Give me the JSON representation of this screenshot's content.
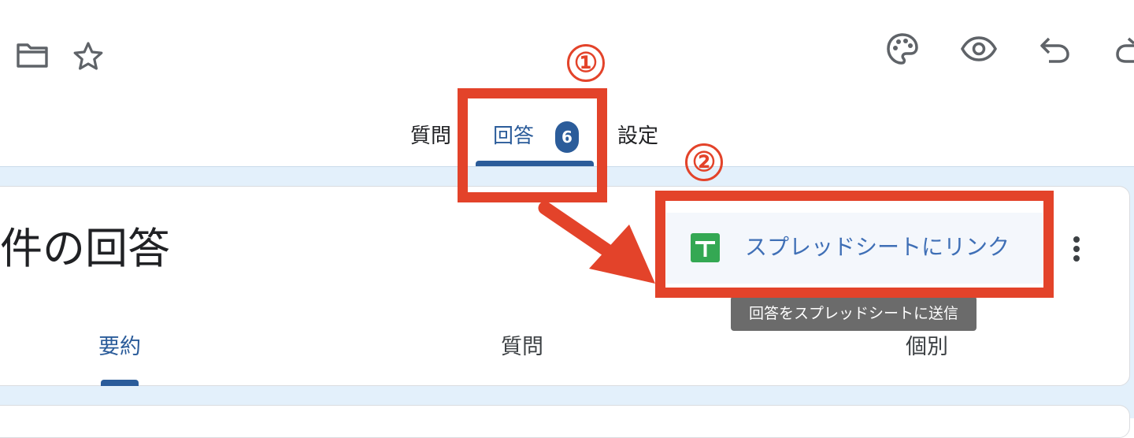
{
  "toolbar": {
    "left_icons": [
      "folder-icon",
      "star-icon"
    ],
    "right_icons": [
      "palette-icon",
      "eye-icon",
      "undo-icon",
      "redo-icon"
    ]
  },
  "tabs": [
    {
      "label": "質問",
      "active": false
    },
    {
      "label": "回答",
      "active": true,
      "badge": "6"
    },
    {
      "label": "設定",
      "active": false
    }
  ],
  "responses": {
    "title": "件の回答",
    "link_button": {
      "icon": "sheets-icon",
      "label": "スプレッドシートにリンク"
    },
    "tooltip": "回答をスプレッドシートに送信",
    "more_icon": "more-vert-icon",
    "subtabs": [
      {
        "label": "要約",
        "active": true
      },
      {
        "label": "質問",
        "active": false
      },
      {
        "label": "個別",
        "active": false
      }
    ]
  },
  "annotations": {
    "marker_1": "①",
    "marker_2": "②",
    "color": "#e3432a"
  },
  "colors": {
    "accent": "#2b5c9a",
    "link": "#3f6fb6",
    "background": "#e3f0fb",
    "sheets_green": "#34a853"
  }
}
